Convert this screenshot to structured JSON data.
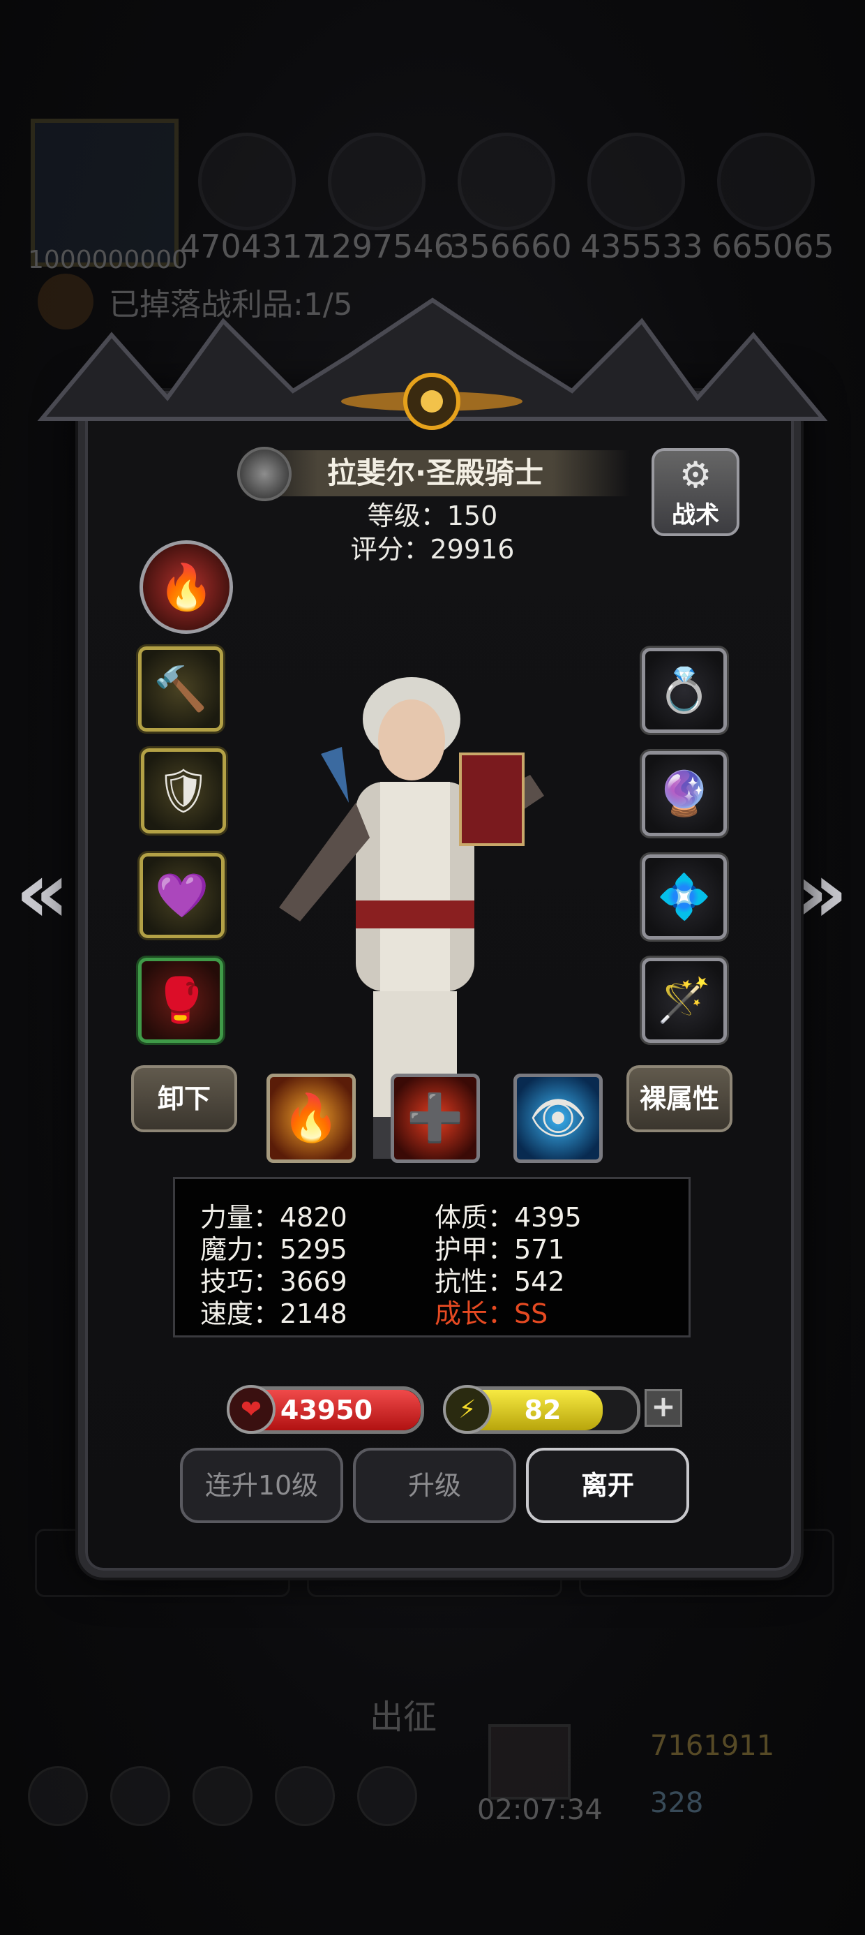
{
  "background": {
    "resources": [
      "1000000000",
      "4704317",
      "1297546",
      "356660",
      "435533",
      "665065"
    ],
    "loot_text": "已掉落战利品:1/5",
    "depart_label": "出征",
    "timer": "02:07:34",
    "gold": "7161911",
    "gems": "328"
  },
  "hero": {
    "name": "拉斐尔·圣殿骑士",
    "level_text": "等级：150",
    "score_text": "评分：29916"
  },
  "buttons": {
    "tactics": "战术",
    "unequip": "卸下",
    "base_attributes": "裸属性",
    "level_up_10": "连升10级",
    "level_up": "升级",
    "leave": "离开"
  },
  "stats": {
    "strength": "力量：4820",
    "constitution": "体质：4395",
    "magic": "魔力：5295",
    "armor": "护甲：571",
    "skill": "技巧：3669",
    "resistance": "抗性：542",
    "speed": "速度：2148",
    "growth": "成长：SS"
  },
  "bars": {
    "hp": "43950",
    "hp_fill": 1.0,
    "energy": "82",
    "energy_fill": 0.82
  },
  "icons": {
    "arrow_left": "«",
    "arrow_right": "»",
    "gear": "⚙",
    "heart": "❤",
    "bolt": "⚡",
    "plus": "+"
  }
}
